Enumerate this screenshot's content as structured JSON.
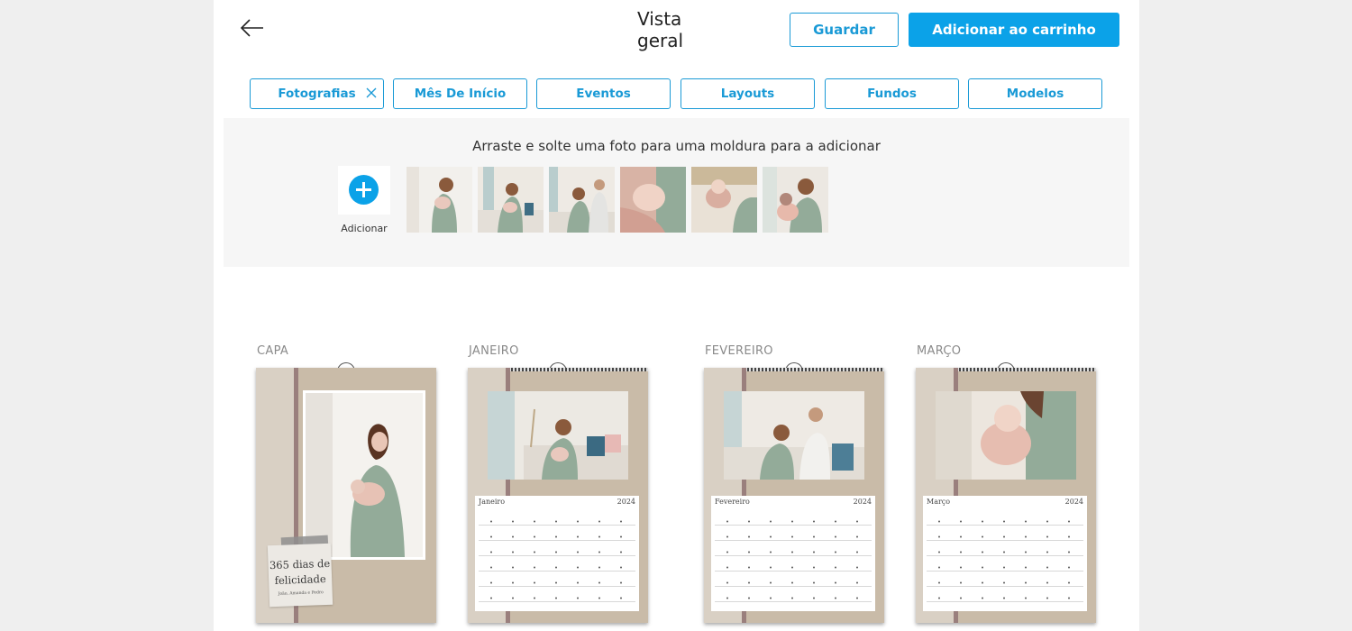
{
  "header": {
    "title": "Vista geral",
    "save_label": "Guardar",
    "cart_label": "Adicionar ao carrinho"
  },
  "tabs": [
    {
      "label": "Fotografias",
      "active": true
    },
    {
      "label": "Mês De Início"
    },
    {
      "label": "Eventos"
    },
    {
      "label": "Layouts"
    },
    {
      "label": "Fundos"
    },
    {
      "label": "Modelos"
    }
  ],
  "photos": {
    "hint": "Arraste e solte uma foto para uma moldura para a adicionar",
    "add_label": "Adicionar"
  },
  "pages": [
    {
      "label": "CAPA",
      "cover_text": "365 dias de felicidade",
      "cover_names": "João, Amanda e Pedro"
    },
    {
      "label": "JANEIRO",
      "month": "Janeiro",
      "year": "2024"
    },
    {
      "label": "FEVEREIRO",
      "month": "Fevereiro",
      "year": "2024"
    },
    {
      "label": "MARÇO",
      "month": "Março",
      "year": "2024"
    }
  ],
  "colors": {
    "accent": "#0ba2e8",
    "outline": "#1a9ad6"
  }
}
